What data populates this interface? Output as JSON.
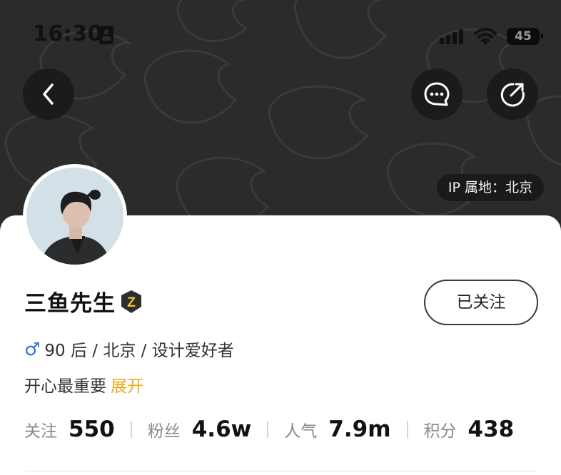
{
  "status_bar": {
    "time": "16:30",
    "battery": "45"
  },
  "header": {
    "ip_location": "IP 属地：北京"
  },
  "profile": {
    "name": "三鱼先生",
    "level_badge": "Z",
    "follow_button": "已关注",
    "gender_symbol": "♂",
    "info": "90 后 / 北京 / 设计爱好者",
    "bio": "开心最重要",
    "bio_more": "展开"
  },
  "stats": [
    {
      "label": "关注",
      "value": "550"
    },
    {
      "label": "粉丝",
      "value": "4.6w"
    },
    {
      "label": "人气",
      "value": "7.9m"
    },
    {
      "label": "积分",
      "value": "438"
    }
  ],
  "colors": {
    "header_bg": "#2b2b2b",
    "accent": "#f0a818",
    "gender": "#2f6fe0",
    "badge": "#f5c22a"
  },
  "icons": {
    "back": "chevron-left-icon",
    "message": "chat-bubble-icon",
    "share": "share-icon",
    "id_card": "id-card-icon"
  }
}
